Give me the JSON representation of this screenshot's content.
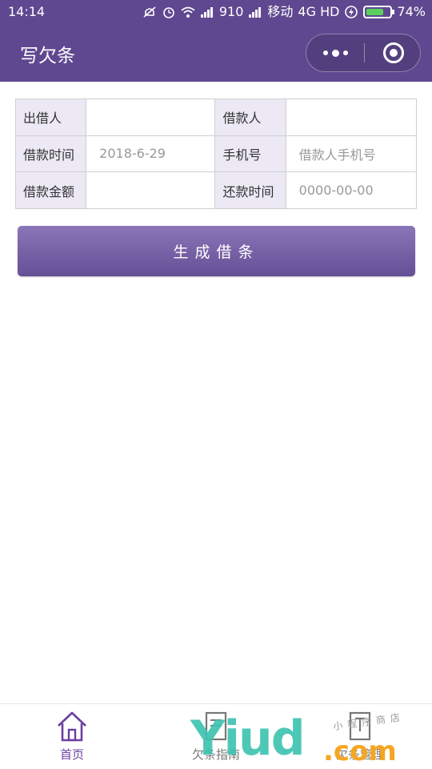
{
  "status_bar": {
    "time": "14:14",
    "signal1_label": "910",
    "carrier": "移动",
    "network": "4G HD",
    "battery_percent": "74%",
    "battery_level": 0.74
  },
  "header": {
    "title": "写欠条",
    "color": "#5f4890"
  },
  "form": {
    "rows": [
      {
        "label1": "出借人",
        "value1": "",
        "label2": "借款人",
        "value2": ""
      },
      {
        "label1": "借款时间",
        "value1": "2018-6-29",
        "label2": "手机号",
        "value2": "借款人手机号"
      },
      {
        "label1": "借款金额",
        "value1": "",
        "label2": "还款时间",
        "value2": "0000-00-00"
      }
    ]
  },
  "generate_button": {
    "label": "生成借条"
  },
  "tabbar": {
    "tabs": [
      {
        "label": "首页",
        "icon": "home-icon",
        "active": true
      },
      {
        "label": "欠条指南",
        "icon": "guide-icon",
        "active": false
      },
      {
        "label": "欠条管理",
        "icon": "manage-icon",
        "active": false
      }
    ],
    "active_color": "#6c3fa0"
  },
  "watermark": {
    "main": "Yiud",
    "suffix": ".com",
    "small": "小程序商店"
  }
}
